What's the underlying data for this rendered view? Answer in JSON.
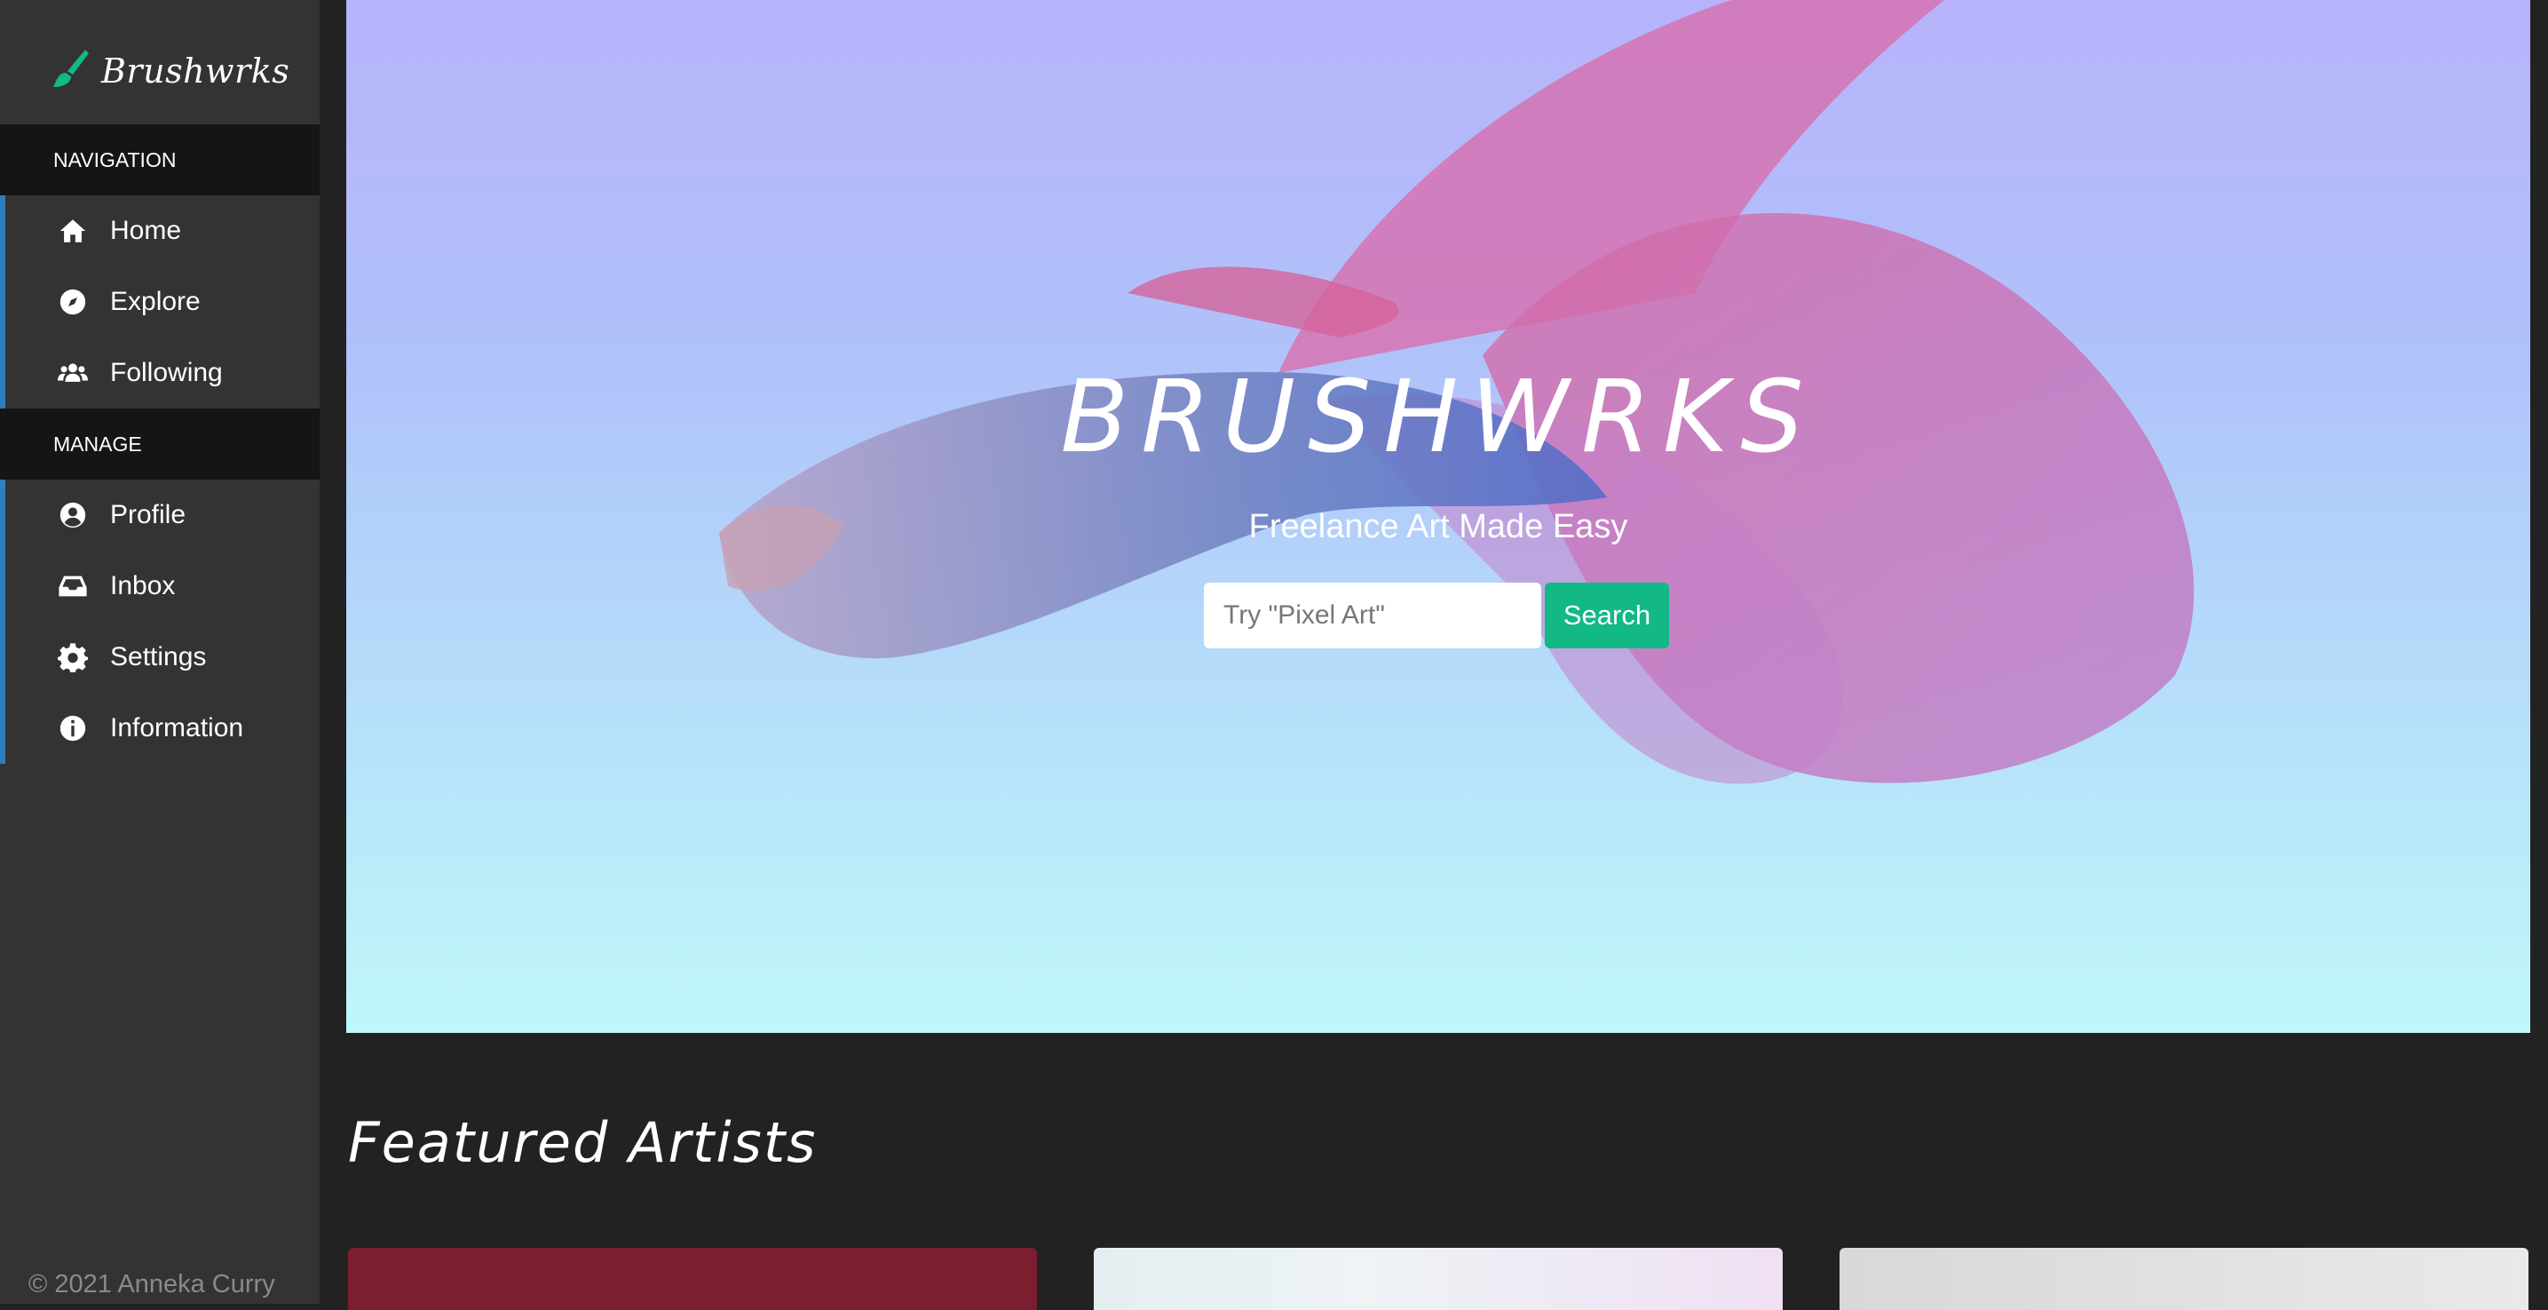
{
  "brand": {
    "name": "Brushwrks",
    "accent": "#12b886"
  },
  "sidebar": {
    "sections": [
      {
        "heading": "NAVIGATION",
        "items": [
          {
            "label": "Home",
            "icon": "home-icon"
          },
          {
            "label": "Explore",
            "icon": "compass-icon"
          },
          {
            "label": "Following",
            "icon": "users-icon"
          }
        ]
      },
      {
        "heading": "MANAGE",
        "items": [
          {
            "label": "Profile",
            "icon": "user-circle-icon"
          },
          {
            "label": "Inbox",
            "icon": "inbox-icon"
          },
          {
            "label": "Settings",
            "icon": "gear-icon"
          },
          {
            "label": "Information",
            "icon": "info-icon"
          }
        ]
      }
    ],
    "copyright": "© 2021 Anneka Curry"
  },
  "hero": {
    "title": "BRUSHWRKS",
    "subtitle": "Freelance Art Made Easy",
    "search": {
      "placeholder": "Try \"Pixel Art\"",
      "value": "",
      "button_label": "Search"
    }
  },
  "featured": {
    "heading": "Featured Artists",
    "cards": [
      "artist-card-1",
      "artist-card-2",
      "artist-card-3"
    ]
  }
}
